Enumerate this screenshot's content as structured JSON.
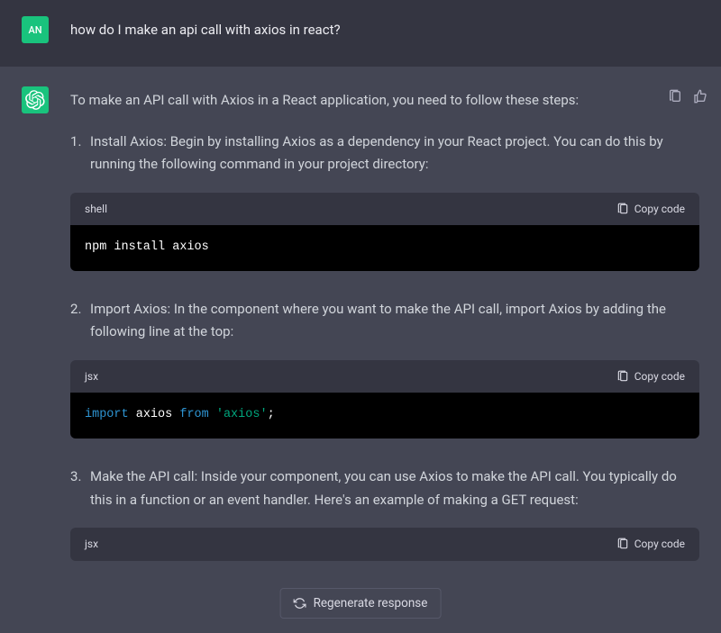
{
  "user": {
    "avatar_initials": "AN",
    "message": "how do I make an api call with axios in react?"
  },
  "assistant": {
    "intro": "To make an API call with Axios in a React application, you need to follow these steps:",
    "steps": [
      {
        "text": "Install Axios: Begin by installing Axios as a dependency in your React project. You can do this by running the following command in your project directory:",
        "code_lang": "shell",
        "code": "npm install axios"
      },
      {
        "text": "Import Axios: In the component where you want to make the API call, import Axios by adding the following line at the top:",
        "code_lang": "jsx",
        "code_tokens": {
          "kw1": "import",
          "var1": "axios",
          "kw2": "from",
          "str1": "'axios'",
          "end": ";"
        }
      },
      {
        "text": "Make the API call: Inside your component, you can use Axios to make the API call. You typically do this in a function or an event handler. Here's an example of making a GET request:",
        "code_lang": "jsx"
      }
    ]
  },
  "ui": {
    "copy_label": "Copy code",
    "regenerate_label": "Regenerate response"
  }
}
